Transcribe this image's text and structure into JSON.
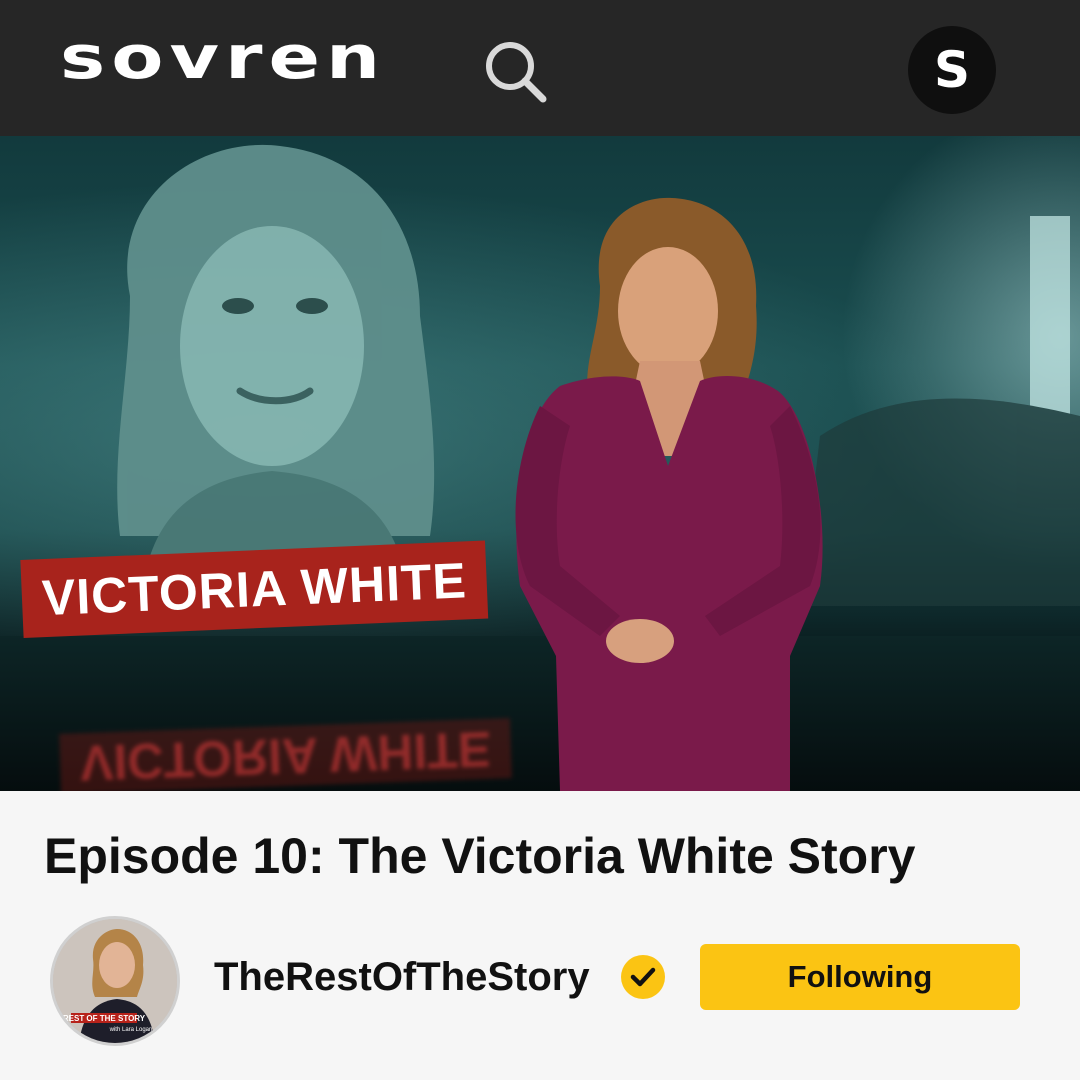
{
  "header": {
    "logo_text": "sovren",
    "search_icon": "search-icon",
    "profile_initial": "S"
  },
  "video": {
    "lower_third_name": "VICTORIA WHITE",
    "accent_color": "#a8231c"
  },
  "episode": {
    "title": "Episode 10: The Victoria White Story"
  },
  "channel": {
    "name": "TheRestOfTheStory",
    "verified_icon": "verified-check-icon",
    "verified_color": "#fbc413",
    "avatar_caption": "REST OF THE STORY",
    "avatar_subcaption": "with Lara Logan"
  },
  "follow_button": {
    "label": "Following",
    "color": "#fbc413"
  }
}
